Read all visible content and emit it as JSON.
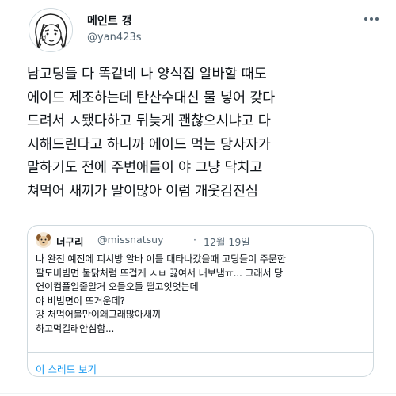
{
  "tweet": {
    "author_name": "메인트 갱",
    "author_handle": "@yan423s",
    "avatar_icon": "sketch-girl-avatar-icon",
    "more_icon": "more-options-icon",
    "text_lines": [
      "남고딩들 다 똑같네 나 양식집 알바할 때도",
      "에이드 제조하는데 탄산수대신 물 넣어 갖다",
      "드려서 ㅅ됐다하고 뒤늦게 괜찮으시냐고 다",
      "시해드린다고 하니까 에이드 먹는 당사자가",
      "말하기도 전에 주변애들이 야 그냥 닥치고",
      "쳐먹어 새끼가 말이많아 이럼 개웃김진심"
    ]
  },
  "quote": {
    "author_name": "너구리",
    "author_handle": "@missnatsuy",
    "separator": "·",
    "date": "12월 19일",
    "avatar_icon": "dog-face-avatar-icon",
    "text_lines": [
      "나 완전 예전에 피시방 알바 이틀 대타나갔을때 고딩들이 주문한",
      "팔도비빔면 불닭처럼 뜨겁게 ㅅㅂ 끓여서 내보냄ㅠ... 그래서 당",
      "연이컴플일줄알거 오들오들 떨고잇엇는데",
      "야 비빔면이 뜨거운데?",
      "걍 처먹어불만이왜그래많아새끼",
      "하고먹길래안심함..."
    ],
    "show_thread_label": "이 스레드 보기"
  },
  "colors": {
    "text_primary": "#0f1419",
    "text_secondary": "#536471",
    "link": "#1d9bf0",
    "border": "#cfd9de"
  }
}
